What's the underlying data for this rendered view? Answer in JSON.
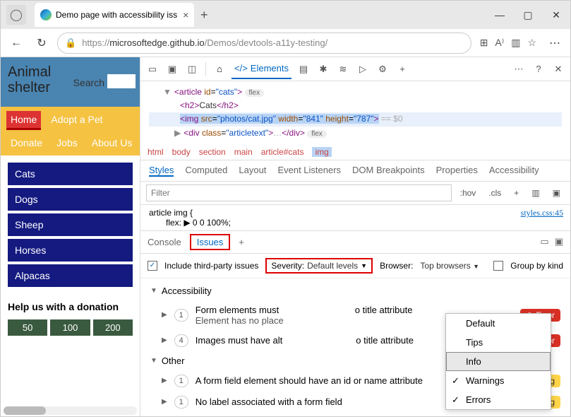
{
  "browser": {
    "tab_title": "Demo page with accessibility iss",
    "url_host": "microsoftedge.github.io",
    "url_path": "/Demos/devtools-a11y-testing/",
    "url_scheme": "https://"
  },
  "page": {
    "title_line1": "Animal",
    "title_line2": "shelter",
    "search_label": "Search",
    "nav": [
      "Home",
      "Adopt a Pet",
      "Donate",
      "Jobs",
      "About Us"
    ],
    "categories": [
      "Cats",
      "Dogs",
      "Sheep",
      "Horses",
      "Alpacas"
    ],
    "donate_heading": "Help us with a donation",
    "donate_amounts": [
      "50",
      "100",
      "200"
    ]
  },
  "devtools": {
    "elements_tab": "Elements",
    "dom": {
      "cats_text": "Cats",
      "img_src": "photos/cat.jpg",
      "img_w": "841",
      "img_h": "787",
      "eq0": "== $0"
    },
    "breadcrumb": [
      "html",
      "body",
      "section",
      "main",
      "article#cats",
      "img"
    ],
    "style_tabs": [
      "Styles",
      "Computed",
      "Layout",
      "Event Listeners",
      "DOM Breakpoints",
      "Properties",
      "Accessibility"
    ],
    "filter_placeholder": "Filter",
    "hov": ":hov",
    "cls": ".cls",
    "css_selector": "article img {",
    "css_rule": "flex: ▶ 0 0 100%;",
    "css_link": "styles.css:45",
    "drawer": {
      "console": "Console",
      "issues": "Issues"
    },
    "filters": {
      "include3p": "Include third-party issues",
      "severity_label": "Severity:",
      "severity_value": "Default levels",
      "browser_label": "Browser:",
      "browser_value": "Top browsers",
      "group": "Group by kind"
    },
    "severity_menu": [
      "Default",
      "Tips",
      "Info",
      "Warnings",
      "Errors"
    ],
    "groups": {
      "a11y": "Accessibility",
      "other": "Other"
    },
    "issues": {
      "a1_count": "1",
      "a1_text_a": "Form elements must ",
      "a1_text_b": "o title attribute",
      "a1_sub": "Element has no place",
      "a2_count": "4",
      "a2_text_a": "Images must have alt",
      "a2_text_b": "o title attribute",
      "o1_count": "1",
      "o1_text": "A form field element should have an id or name attribute",
      "o2_count": "1",
      "o2_text": "No label associated with a form field"
    },
    "badges": {
      "error": "Error",
      "warning": "Warning"
    }
  }
}
